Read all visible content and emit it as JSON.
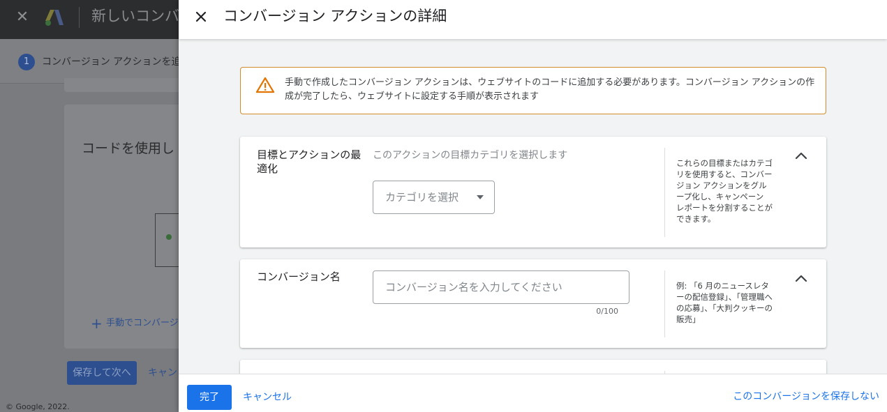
{
  "background": {
    "title": "新しいコンバ",
    "step": {
      "number": "1",
      "label": "コンバージョン アクションを追"
    },
    "card_title": "コードを使用し",
    "add_link": "手動でコンバージ",
    "save_button": "保存して次へ",
    "cancel_link": "キャン",
    "copyright": "© Google, 2022."
  },
  "drawer": {
    "title": "コンバージョン アクションの詳細",
    "warning": "手動で作成したコンバージョン アクションは、ウェブサイトのコードに追加する必要があります。コンバージョン アクションの作成が完了したら、ウェブサイトに設定する手順が表示されます",
    "sections": {
      "goal": {
        "label": "目標とアクションの最適化",
        "subtitle": "このアクションの目標カテゴリを選択します",
        "select_placeholder": "カテゴリを選択",
        "help": "これらの目標またはカテゴリを使用すると、コンバージョン アクションをグループ化し、キャンペーン レポートを分割することができます。"
      },
      "name": {
        "label": "コンバージョン名",
        "input_value": "",
        "input_placeholder": "コンバージョン名を入力してください",
        "char_count": "0/100",
        "help": "例: 「6 月のニュースレターの配信登録」、「管理職への応募」、「大判クッキーの販売」"
      }
    },
    "footer": {
      "done": "完了",
      "cancel": "キャンセル",
      "dont_save": "このコンバージョンを保存しない"
    }
  },
  "colors": {
    "accent": "#1a73e8",
    "warning_border": "#d28b2a",
    "warning_icon": "#e37400"
  }
}
